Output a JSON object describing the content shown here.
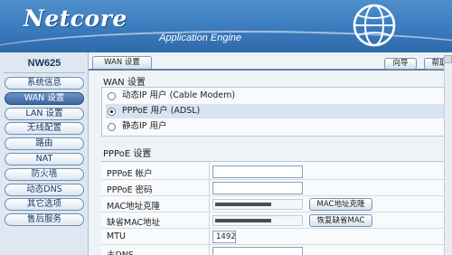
{
  "header": {
    "logo": "Netcore",
    "tagline": "Application Engine"
  },
  "sidebar": {
    "model": "NW625",
    "items": [
      {
        "label": "系统信息",
        "active": false
      },
      {
        "label": "WAN 设置",
        "active": true
      },
      {
        "label": "LAN 设置",
        "active": false
      },
      {
        "label": "无线配置",
        "active": false
      },
      {
        "label": "路由",
        "active": false
      },
      {
        "label": "NAT",
        "active": false
      },
      {
        "label": "防火墙",
        "active": false
      },
      {
        "label": "动态DNS",
        "active": false
      },
      {
        "label": "其它选项",
        "active": false
      },
      {
        "label": "售后服务",
        "active": false
      }
    ]
  },
  "main": {
    "tab": "WAN 设置",
    "guide_button": "向导",
    "help_button": "帮助",
    "wan_title": "WAN 设置",
    "wan_options": [
      {
        "label": "动态IP 用户 (Cable Modem)",
        "selected": false
      },
      {
        "label": "PPPoE 用户 (ADSL)",
        "selected": true
      },
      {
        "label": "静态IP 用户",
        "selected": false
      }
    ],
    "pppoe_title": "PPPoE 设置",
    "fields": {
      "account_label": "PPPoE 帐户",
      "account_value": "",
      "password_label": "PPPoE 密码",
      "password_value": "",
      "mac_clone_label": "MAC地址克隆",
      "mac_clone_button": "MAC地址克隆",
      "default_mac_label": "缺省MAC地址",
      "default_mac_button": "恢复缺省MAC",
      "mtu_label": "MTU",
      "mtu_value": "1492",
      "dns_label": "主DNS"
    }
  },
  "colors": {
    "header_blue": "#3b7bbd",
    "active_menu": "#3d67a1",
    "accent_line": "#5c7fa7"
  }
}
